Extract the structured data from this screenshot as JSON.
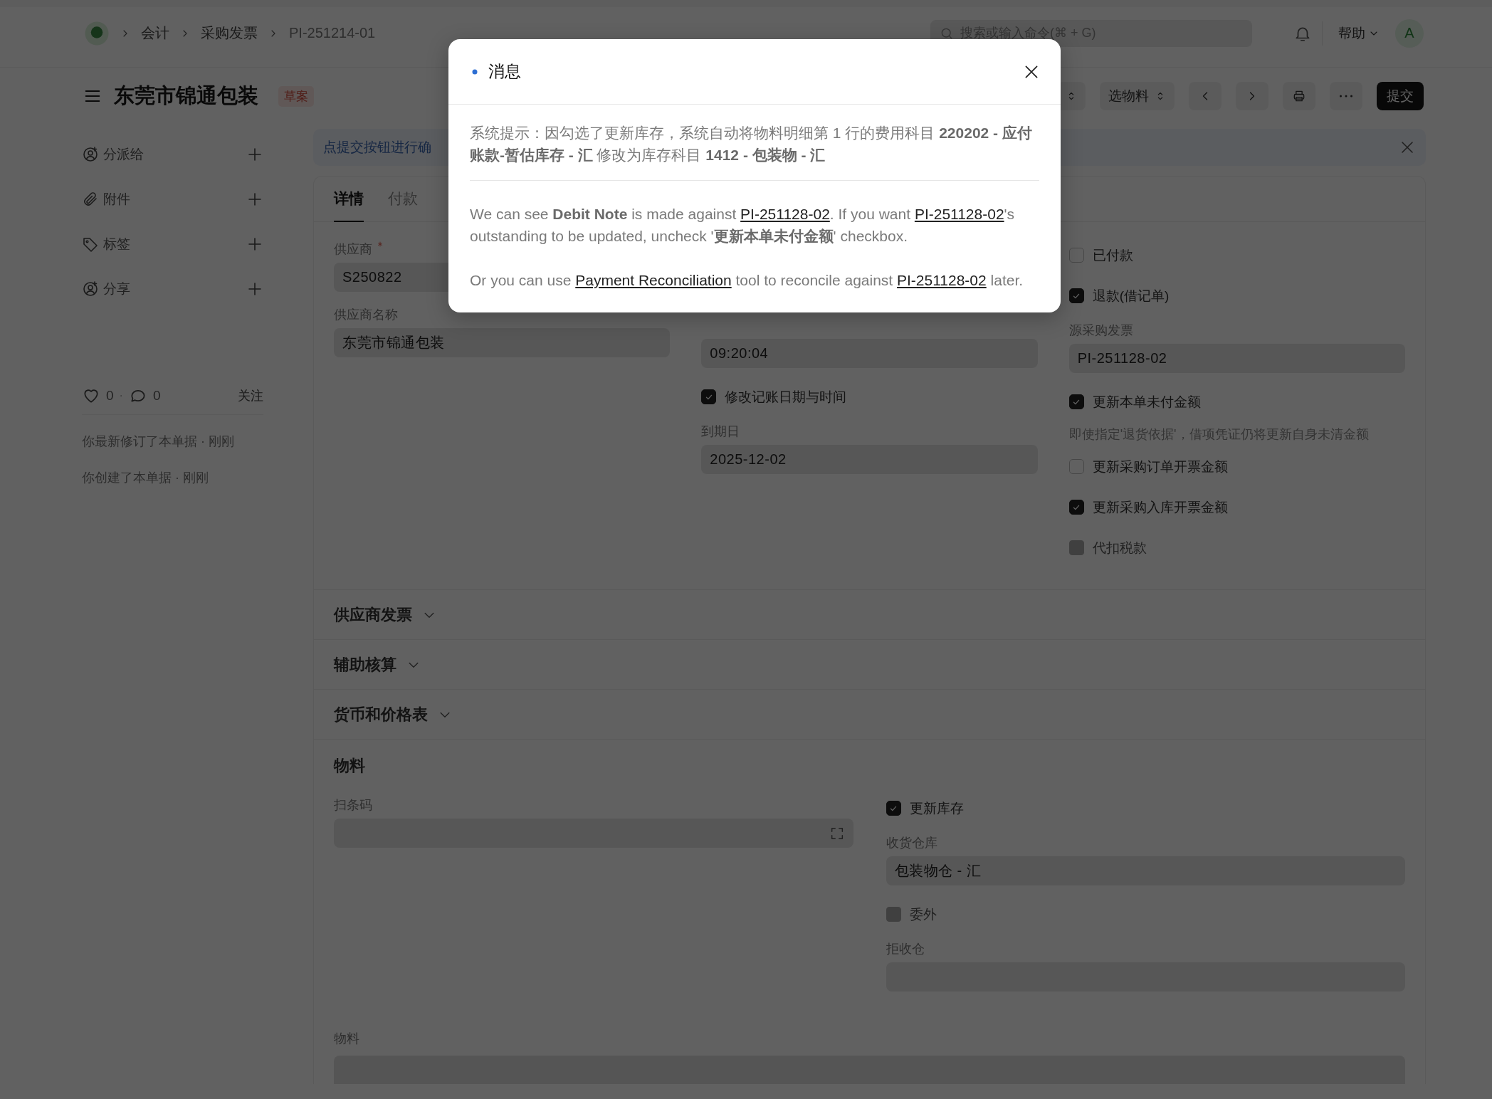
{
  "topbar": {
    "breadcrumbs": [
      "会计",
      "采购发票",
      "PI-251214-01"
    ],
    "search": {
      "placeholder": "搜索或输入命令(⌘ + G)"
    },
    "help": "帮助",
    "avatar": "A"
  },
  "header": {
    "title": "东莞市锦通包装",
    "status": "草案",
    "buttons": [
      {
        "kind": "select"
      },
      {
        "kind": "select",
        "label": "选物料"
      },
      {
        "kind": "prev"
      },
      {
        "kind": "next"
      },
      {
        "kind": "print"
      },
      {
        "kind": "more"
      },
      {
        "kind": "primary",
        "label": "提交"
      }
    ]
  },
  "sidebar": {
    "actions": [
      {
        "kind": "assign",
        "label": "分派给"
      },
      {
        "kind": "attach",
        "label": "附件"
      },
      {
        "kind": "tag",
        "label": "标签"
      },
      {
        "kind": "share",
        "label": "分享"
      }
    ],
    "likes": "0",
    "separator": "·",
    "comments": "0",
    "follow": "关注",
    "activity": [
      "你最新修订了本单据 · 刚刚",
      "你创建了本单据 · 刚刚"
    ]
  },
  "alert": {
    "text": "点提交按钮进行确"
  },
  "tabs": [
    {
      "label": "详情",
      "selected": true
    },
    {
      "label": "付款",
      "selected": false
    }
  ],
  "details": {
    "columns": [
      [
        {
          "kind": "field",
          "label": "供应商",
          "required": true,
          "value": "S250822"
        },
        {
          "kind": "field",
          "label": "供应商名称",
          "value": "东莞市锦通包装"
        }
      ],
      [
        {
          "kind": "field",
          "value": "09:20:04"
        },
        {
          "kind": "check",
          "label": "修改记账日期与时间",
          "checked": true,
          "disabled": false
        },
        {
          "kind": "field",
          "label": "到期日",
          "value": "2025-12-02"
        }
      ],
      [
        {
          "kind": "check",
          "label": "已付款",
          "checked": false,
          "disabled": false
        },
        {
          "kind": "check",
          "label": "退款(借记单)",
          "checked": true,
          "disabled": false
        },
        {
          "kind": "field",
          "label": "源采购发票",
          "value": "PI-251128-02"
        },
        {
          "kind": "check",
          "label": "更新本单未付金额",
          "checked": true,
          "disabled": false
        },
        {
          "kind": "note",
          "text": "即使指定'退货依据'，借项凭证仍将更新自身未清金额"
        },
        {
          "kind": "check",
          "label": "更新采购订单开票金额",
          "checked": false,
          "disabled": false
        },
        {
          "kind": "check",
          "label": "更新采购入库开票金额",
          "checked": true,
          "disabled": false
        },
        {
          "kind": "check",
          "label": "代扣税款",
          "checked": false,
          "disabled": true
        }
      ]
    ]
  },
  "sections": [
    {
      "title": "供应商发票",
      "expanded": false
    },
    {
      "title": "辅助核算",
      "expanded": false
    },
    {
      "title": "货币和价格表",
      "expanded": false
    }
  ],
  "items_section": {
    "title": "物料",
    "columns": [
      [
        {
          "kind": "scan",
          "label": "扫条码"
        }
      ],
      [
        {
          "kind": "check",
          "label": "更新库存",
          "checked": true,
          "disabled": false
        },
        {
          "kind": "field",
          "label": "收货仓库",
          "value": "包装物仓 - 汇"
        },
        {
          "kind": "check",
          "label": "委外",
          "checked": false,
          "disabled": true
        },
        {
          "kind": "field",
          "label": "拒收仓"
        }
      ]
    ],
    "table_label": "物料"
  },
  "dialog": {
    "title": "消息",
    "notice": "系统提示：因勾选了更新库存，系统自动将物料明细第 1 行的费用科目 **220202 - 应付账款-暂估库存 - 汇** 修改为库存科目 **1412 - 包装物 - 汇**",
    "messages": [
      [
        {
          "text": "We can see **Debit Note** is made against "
        },
        {
          "link": "PI-251128-02"
        },
        {
          "text": ". If you want "
        },
        {
          "link": "PI-251128-02"
        },
        {
          "text": "'s outstanding to be updated, uncheck '**更新本单未付金额**' checkbox."
        }
      ],
      [
        {
          "text": "Or you can use "
        },
        {
          "link": "Payment Reconciliation"
        },
        {
          "text": " tool to reconcile against "
        },
        {
          "link": "PI-251128-02"
        },
        {
          "text": " later."
        }
      ]
    ]
  }
}
